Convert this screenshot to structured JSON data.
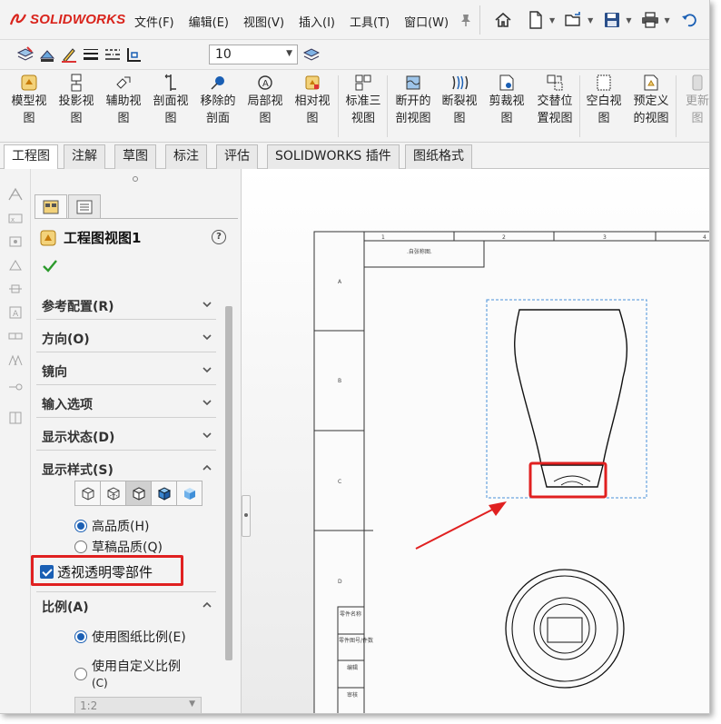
{
  "app": {
    "brand": "SOLIDWORKS"
  },
  "menu": [
    "文件(F)",
    "编辑(E)",
    "视图(V)",
    "插入(I)",
    "工具(T)",
    "窗口(W)"
  ],
  "toolbar2": {
    "layer_value": "10"
  },
  "commands": [
    {
      "line1": "模型视",
      "line2": "图"
    },
    {
      "line1": "投影视",
      "line2": "图"
    },
    {
      "line1": "辅助视",
      "line2": "图"
    },
    {
      "line1": "剖面视",
      "line2": "图"
    },
    {
      "line1": "移除的",
      "line2": "剖面"
    },
    {
      "line1": "局部视",
      "line2": "图"
    },
    {
      "line1": "相对视",
      "line2": "图"
    },
    {
      "line1": "标准三",
      "line2": "视图"
    },
    {
      "line1": "断开的",
      "line2": "剖视图"
    },
    {
      "line1": "断裂视",
      "line2": "图"
    },
    {
      "line1": "剪裁视",
      "line2": "图"
    },
    {
      "line1": "交替位",
      "line2": "置视图"
    },
    {
      "line1": "空白视",
      "line2": "图"
    },
    {
      "line1": "预定义",
      "line2": "的视图"
    },
    {
      "line1": "更新",
      "line2": "图"
    }
  ],
  "tabs": [
    "工程图",
    "注解",
    "草图",
    "标注",
    "评估",
    "SOLIDWORKS 插件",
    "图纸格式"
  ],
  "panel": {
    "title": "工程图视图1",
    "groups": [
      "参考配置(R)",
      "方向(O)",
      "镜向",
      "输入选项",
      "显示状态(D)",
      "显示样式(S)"
    ],
    "quality_options": [
      "高品质(H)",
      "草稿品质(Q)"
    ],
    "transparent_checkbox": "透视透明零部件",
    "scale_group": "比例(A)",
    "scale_options": [
      "使用图纸比例(E)",
      "使用自定义比例"
    ],
    "scale_option_hotkey": "(C)",
    "scale_value": "1:2"
  },
  "sheet": {
    "col_labels": [
      "1",
      "2",
      "3",
      "4"
    ],
    "row_labels": [
      "A",
      "B",
      "C",
      "D"
    ],
    "title_cell": ".自张称图.",
    "block_rows": [
      "零件名称",
      "零件图号/件数",
      "编辑",
      "审核"
    ]
  },
  "colors": {
    "highlight_red": "#e02020",
    "accent_blue": "#1a5fb4",
    "brand_red": "#d9241c"
  }
}
